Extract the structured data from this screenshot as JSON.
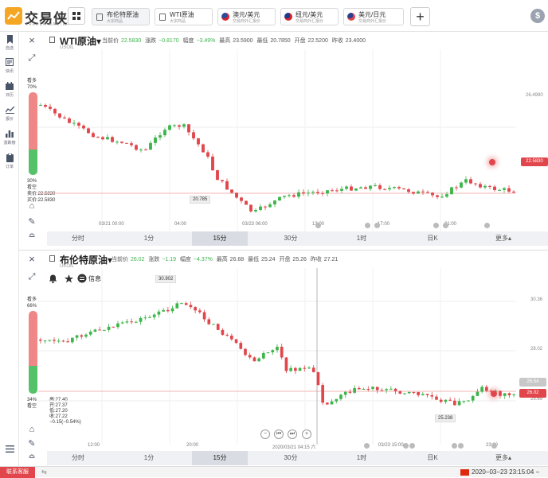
{
  "app": {
    "logo_text": "交易侠",
    "logo_sub": "TRADER MASTER"
  },
  "tabs": [
    {
      "name": "布伦特原油",
      "sub": "大宗商品",
      "icon": "doc-icon"
    },
    {
      "name": "WTI原油",
      "sub": "大宗商品",
      "icon": "doc-icon"
    },
    {
      "name": "澳元/美元",
      "sub": "交易商外汇报价",
      "icon": "flag-au-icon"
    },
    {
      "name": "纽元/美元",
      "sub": "交易商外汇报价",
      "icon": "flag-nz-icon"
    },
    {
      "name": "美元/日元",
      "sub": "交易商外汇报价",
      "icon": "flag-us-icon"
    }
  ],
  "add_tab": "+",
  "user_icon": "$",
  "sidebar": [
    {
      "label": "自选",
      "icon": "bookmark-icon"
    },
    {
      "label": "快讯",
      "icon": "news-icon"
    },
    {
      "label": "日历",
      "icon": "calendar-icon"
    },
    {
      "label": "报价",
      "icon": "chart-line-icon"
    },
    {
      "label": "涨跌榜",
      "icon": "bar-chart-icon"
    },
    {
      "label": "订单",
      "icon": "clipboard-icon"
    }
  ],
  "colors": {
    "up": "#3cb54a",
    "down": "#e0464b",
    "accent": "#f5a623"
  },
  "chart1": {
    "title": "WTI原油",
    "code": "USOIL",
    "current_label": "当前价",
    "current": "22.5830",
    "change_label": "涨跌",
    "change": "−0.8170",
    "pct_label": "幅度",
    "pct": "−3.49%",
    "high_label": "最高",
    "high": "23.5900",
    "low_label": "最低",
    "low": "20.7850",
    "open_label": "开盘",
    "open": "22.5200",
    "prev_label": "昨收",
    "prev": "23.4000",
    "bull_label": "看多",
    "bull_pct": "70%",
    "bear_pct": "30%",
    "bear_label": "看空",
    "bid": "卖价:22.5830",
    "ask": "买价:22.5830",
    "price_tag": "22.5830",
    "y_tick": "26.4990",
    "low_marker": "20.785",
    "x_labels": [
      "03/21 00:00",
      "04:00",
      "03/23 06:00",
      "13:00",
      "17:00",
      "21:00"
    ],
    "timeframes": [
      "分时",
      "1分",
      "15分",
      "30分",
      "1时",
      "日K",
      "更多▴"
    ],
    "active_tf": "15分"
  },
  "chart2": {
    "title": "布伦特原油",
    "code": "UKOIL",
    "current_label": "当前价",
    "current": "26.02",
    "change_label": "涨跌",
    "change": "−1.19",
    "pct_label": "幅度",
    "pct": "−4.37%",
    "high_label": "最高",
    "high": "26.68",
    "low_label": "最低",
    "low": "25.24",
    "open_label": "开盘",
    "open": "25.26",
    "prev_label": "昨收",
    "prev": "27.21",
    "info_label": "信息",
    "bull_label": "看多",
    "bull_pct": "66%",
    "bear_pct": "34%",
    "bear_label": "看空",
    "ohlc": [
      "高:27.40",
      "开:27.37",
      "低:27.20",
      "收:27.22",
      "−0.15(−0.54%)"
    ],
    "y_ticks": [
      "30.36",
      "28.02",
      "25.69"
    ],
    "price_tag": "26.02",
    "cursor_tag": "26.54",
    "high_marker": "30.902",
    "low_marker": "25.238",
    "cursor_time": "2020/03/21 04:15 六",
    "x_labels": [
      "12:00",
      "20:00",
      "03/23 15:00",
      "23:00"
    ],
    "timeframes": [
      "分时",
      "1分",
      "15分",
      "30分",
      "1时",
      "日K",
      "更多▴"
    ],
    "active_tf": "15分"
  },
  "status": {
    "contact": "联系客服",
    "datetime": "2020−03−23 23:15:04 −"
  }
}
